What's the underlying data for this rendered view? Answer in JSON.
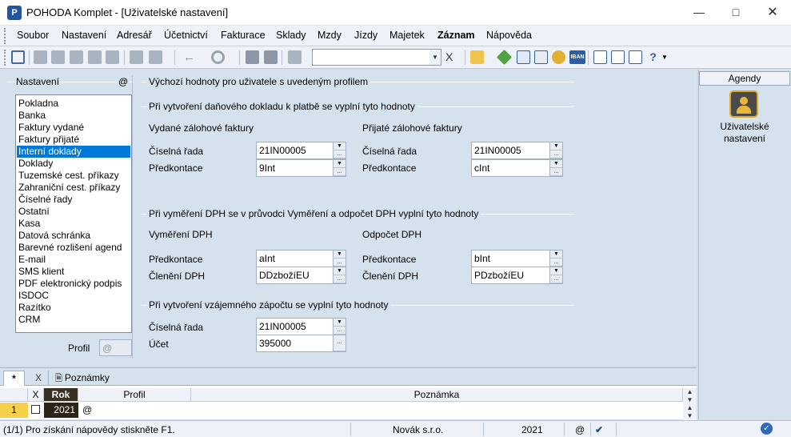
{
  "window": {
    "title": "POHODA Komplet - [Uživatelské nastavení]",
    "app_icon": "pohoda-app-icon",
    "controls": [
      "minimize-icon",
      "maximize-icon",
      "close-icon"
    ]
  },
  "menu": [
    "Soubor",
    "Nastavení",
    "Adresář",
    "Účetnictví",
    "Fakturace",
    "Sklady",
    "Mzdy",
    "Jízdy",
    "Majetek",
    "Záznam",
    "Nápověda"
  ],
  "menu_bold": "Záznam",
  "toolbar": {
    "combo_value": "",
    "icons": [
      "print-preview-icon",
      "copy-icon",
      "find-icon",
      "edit-icon",
      "delete-icon",
      "new-icon",
      "check-icon",
      "back-icon",
      "gear-icon",
      "save-icon",
      "cancel-icon",
      "clipboard-icon",
      "filter-icon",
      "folder-icon",
      "money-icon",
      "calculator-icon",
      "accounting-icon",
      "coins-icon",
      "iban-icon",
      "message-icon",
      "list-icon",
      "window-icon",
      "help-arrow-icon"
    ]
  },
  "left_panel": {
    "title": "Nastavení",
    "at_symbol": "@",
    "items": [
      "Pokladna",
      "Banka",
      "Faktury vydané",
      "Faktury přijaté",
      "Interní doklady",
      "Doklady",
      "Tuzemské cest. příkazy",
      "Zahraniční cest. příkazy",
      "Číselné řady",
      "Ostatní",
      "Kasa",
      "Datová schránka",
      "Barevné rozlišení agend",
      "E-mail",
      "SMS klient",
      "PDF elektronický podpis",
      "ISDOC",
      "Razítko",
      "CRM"
    ],
    "selected_index": 4,
    "profil_label": "Profil",
    "profil_value": "@"
  },
  "content": {
    "header": "Výchozí hodnoty pro uživatele s uvedeným profilem",
    "section1": {
      "title": "Při vytvoření daňového dokladu k platbě se vyplní tyto hodnoty",
      "left": {
        "title": "Vydané zálohové faktury",
        "fields": [
          {
            "label": "Číselná řada",
            "value": "21IN00005"
          },
          {
            "label": "Předkontace",
            "value": "9Int"
          }
        ]
      },
      "right": {
        "title": "Přijaté zálohové faktury",
        "fields": [
          {
            "label": "Číselná řada",
            "value": "21IN00005"
          },
          {
            "label": "Předkontace",
            "value": "cInt"
          }
        ]
      }
    },
    "section2": {
      "title": "Při vyměření DPH se v průvodci Vyměření a odpočet DPH vyplní tyto hodnoty",
      "left": {
        "title": "Vyměření DPH",
        "fields": [
          {
            "label": "Předkontace",
            "value": "aInt"
          },
          {
            "label": "Členění DPH",
            "value": "DDzbožíEU"
          }
        ]
      },
      "right": {
        "title": "Odpočet DPH",
        "fields": [
          {
            "label": "Předkontace",
            "value": "bInt"
          },
          {
            "label": "Členění DPH",
            "value": "PDzbožíEU"
          }
        ]
      }
    },
    "section3": {
      "title": "Při vytvoření vzájemného zápočtu se vyplní tyto hodnoty",
      "fields": [
        {
          "label": "Číselná řada",
          "value": "21IN00005"
        },
        {
          "label": "Účet",
          "value": "395000"
        }
      ]
    }
  },
  "side_panel": {
    "title": "Agendy",
    "item_label_line1": "Uživatelské",
    "item_label_line2": "nastavení",
    "item_icon": "user-settings-icon"
  },
  "bottom_grid": {
    "tab_star": "*",
    "tab_notes": "Poznámky",
    "headers": {
      "x": "X",
      "rok": "Rok",
      "profil": "Profil",
      "poznamka": "Poznámka"
    },
    "row": {
      "num": "1",
      "rok": "2021",
      "profil": "@",
      "poznamka": ""
    }
  },
  "status": {
    "hint": "(1/1) Pro získání nápovědy stiskněte F1.",
    "company": "Novák s.r.o.",
    "year": "2021",
    "at": "@"
  },
  "colors": {
    "selection": "#0078d7",
    "panel": "#d6e1ee",
    "rok_header": "#3a3020"
  }
}
